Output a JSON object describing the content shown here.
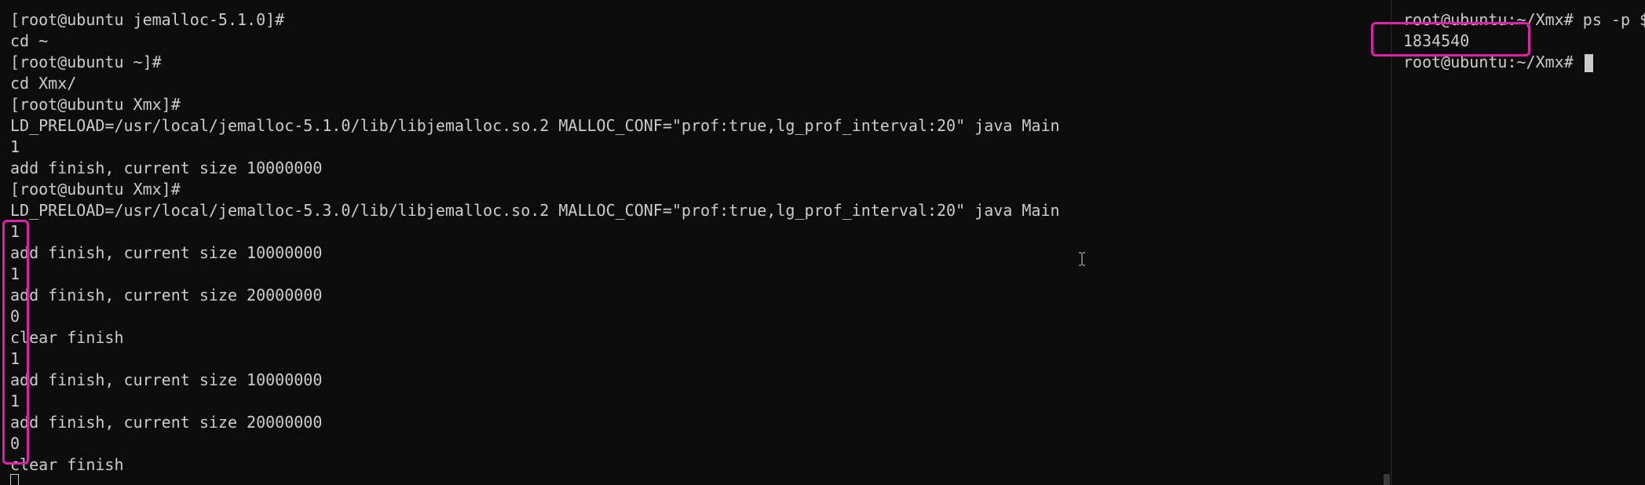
{
  "left_pane": {
    "lines": [
      "[root@ubuntu jemalloc-5.1.0]#",
      "cd ~",
      "[root@ubuntu ~]#",
      "cd Xmx/",
      "[root@ubuntu Xmx]#",
      "LD_PRELOAD=/usr/local/jemalloc-5.1.0/lib/libjemalloc.so.2 MALLOC_CONF=\"prof:true,lg_prof_interval:20\" java Main",
      "1",
      "add finish, current size 10000000",
      "[root@ubuntu Xmx]#",
      "LD_PRELOAD=/usr/local/jemalloc-5.3.0/lib/libjemalloc.so.2 MALLOC_CONF=\"prof:true,lg_prof_interval:20\" java Main",
      "1",
      "add finish, current size 10000000",
      "1",
      "add finish, current size 20000000",
      "0",
      "clear finish",
      "1",
      "add finish, current size 10000000",
      "1",
      "add finish, current size 20000000",
      "0",
      "clear finish"
    ]
  },
  "right_pane": {
    "lines": [
      "root@ubuntu:~/Xmx# ps -p $",
      "1834540",
      "root@ubuntu:~/Xmx# "
    ]
  },
  "colors": {
    "background": "#0c0c0c",
    "text": "#cccccc",
    "highlight": "#e020a8"
  },
  "icons": {
    "text_cursor": "i-beam-icon"
  }
}
